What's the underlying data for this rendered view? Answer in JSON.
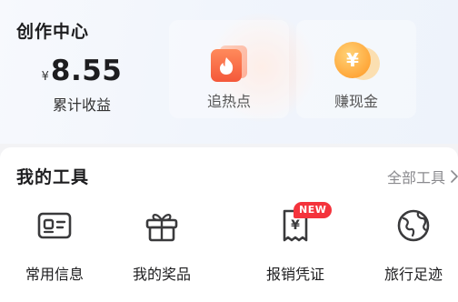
{
  "creator_center": {
    "title": "创作中心",
    "earnings": {
      "currency": "¥",
      "value": "8.55",
      "label": "累计收益"
    },
    "actions": [
      {
        "label": "追热点",
        "icon": "flame-card-icon"
      },
      {
        "label": "赚现金",
        "icon": "yuan-coin-icon"
      }
    ]
  },
  "tools": {
    "title": "我的工具",
    "all_link": "全部工具",
    "items": [
      {
        "label": "常用信息",
        "icon": "id-card-icon"
      },
      {
        "label": "我的奖品",
        "icon": "gift-box-icon"
      },
      {
        "label": "报销凭证",
        "icon": "receipt-icon",
        "badge": "NEW"
      },
      {
        "label": "旅行足迹",
        "icon": "globe-icon"
      }
    ]
  },
  "colors": {
    "badge": "#f4333c",
    "fire": "#ff6a3d",
    "coin": "#ffb340",
    "icon_stroke": "#3a3a3c"
  }
}
